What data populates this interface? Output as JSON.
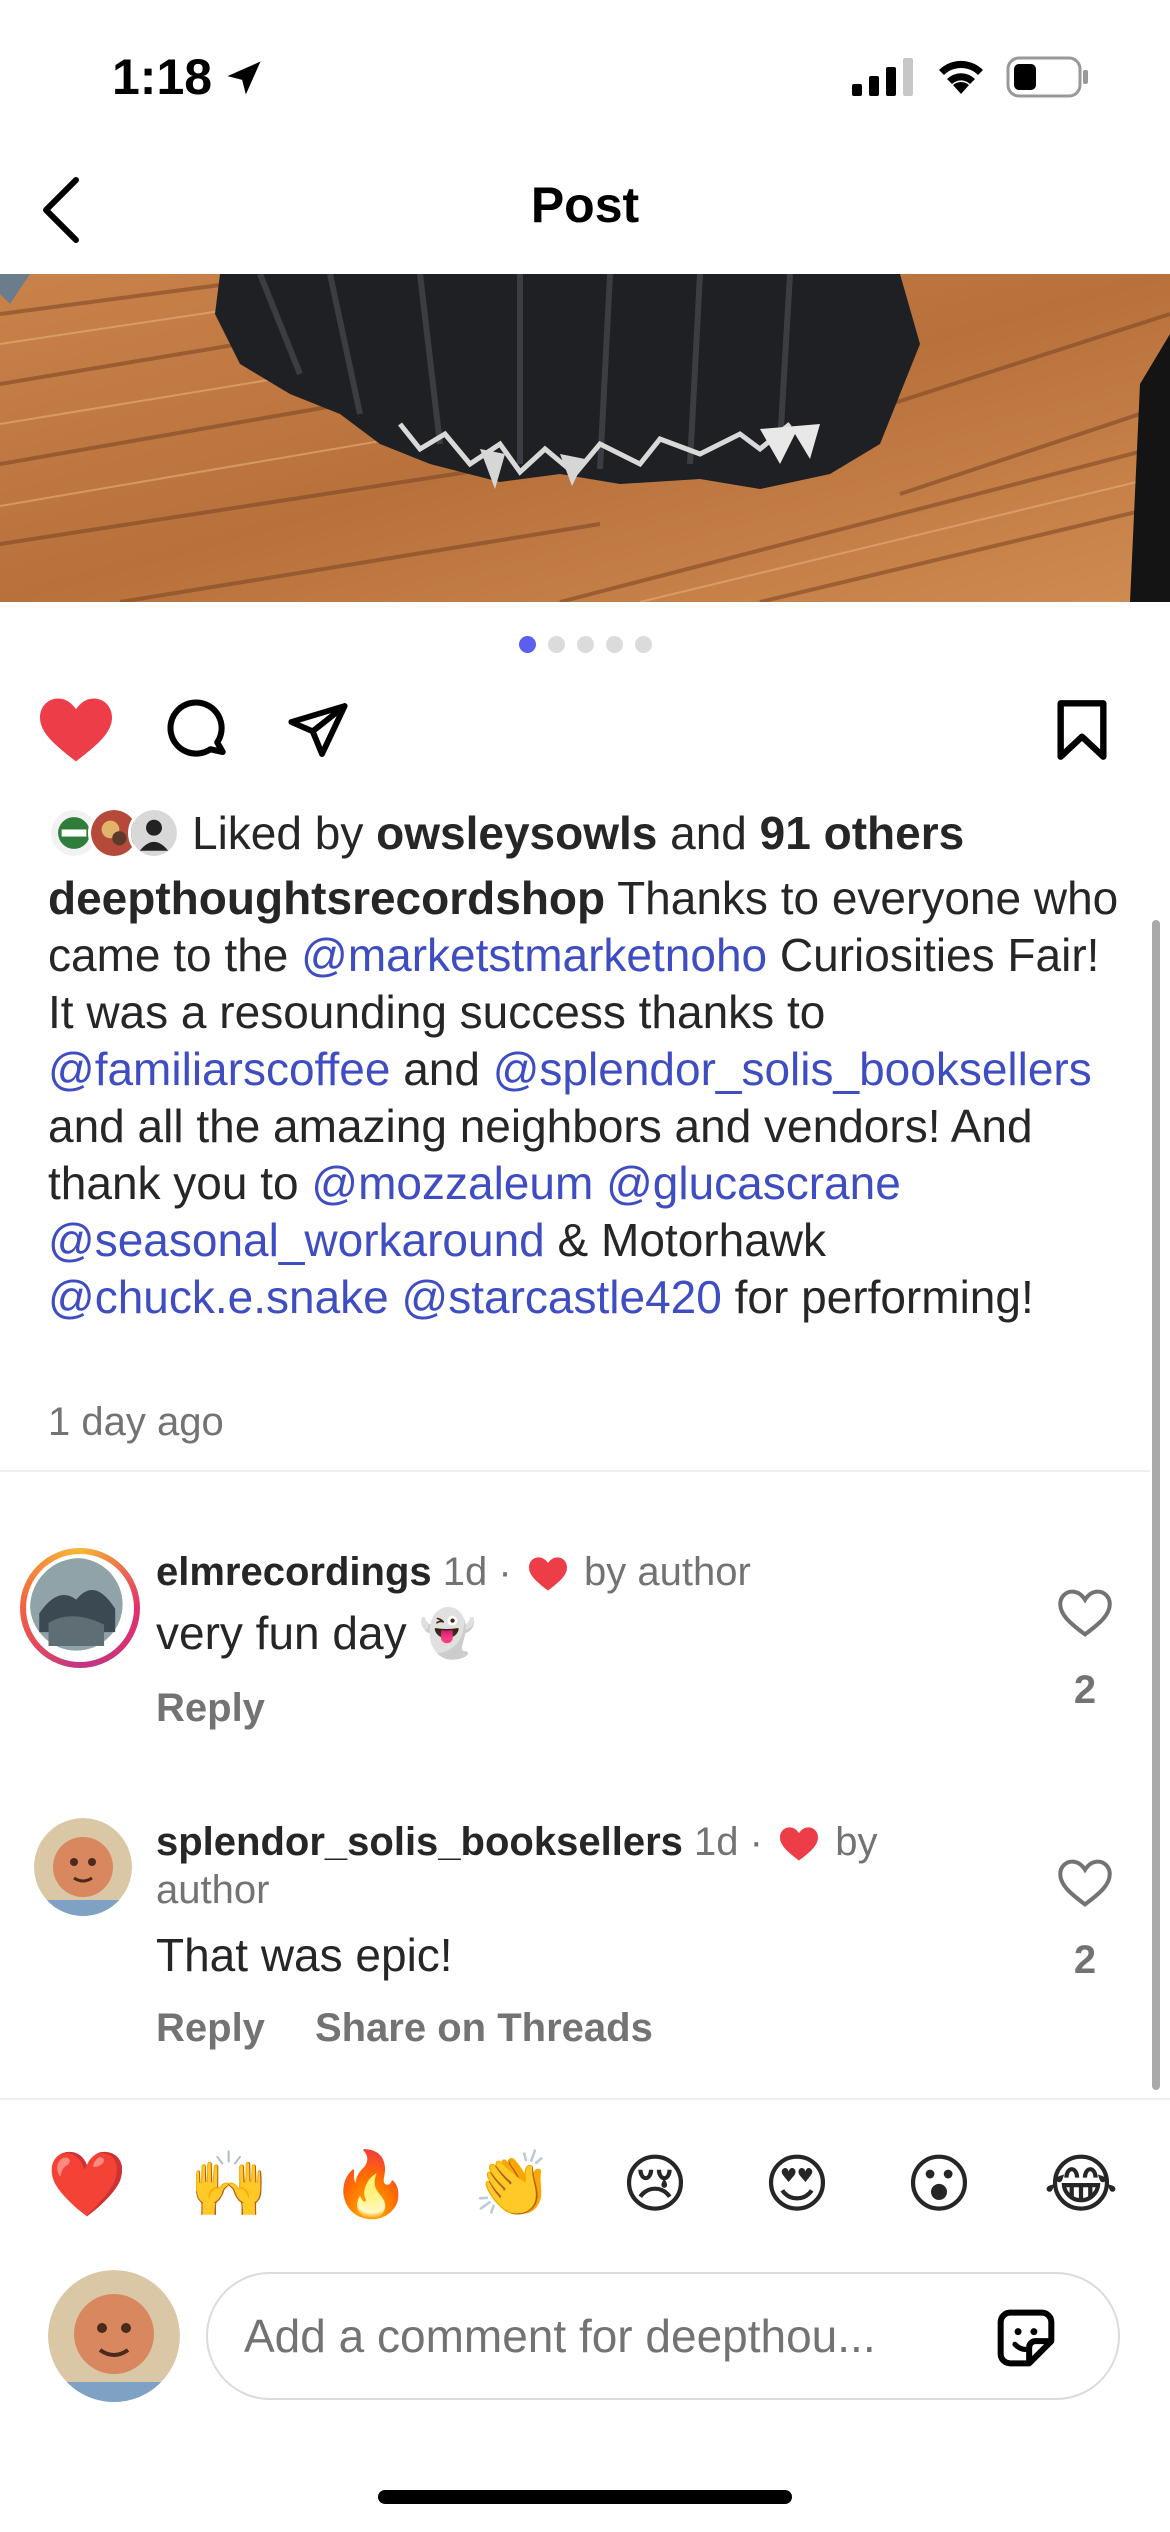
{
  "status_bar": {
    "time": "1:18"
  },
  "header": {
    "title": "Post"
  },
  "carousel": {
    "count": 5,
    "active_index": 0
  },
  "likes": {
    "prefix": "Liked by ",
    "user": "owsleysowls",
    "middle": " and ",
    "others": "91 others"
  },
  "caption": {
    "author": "deepthoughtsrecordshop",
    "parts": [
      {
        "text": " Thanks to everyone who came to the "
      },
      {
        "text": "@marketstmarketnoho",
        "mention": true
      },
      {
        "text": " Curiosities Fair! It was a resounding success thanks to "
      },
      {
        "text": "@familiarscoffee",
        "mention": true
      },
      {
        "text": " and "
      },
      {
        "text": "@splendor_solis_booksellers",
        "mention": true
      },
      {
        "text": " and all the amazing neighbors and vendors! And thank you to "
      },
      {
        "text": "@mozzaleum",
        "mention": true
      },
      {
        "text": " "
      },
      {
        "text": "@glucascrane",
        "mention": true
      },
      {
        "text": " "
      },
      {
        "text": "@seasonal_workaround",
        "mention": true
      },
      {
        "text": " & Motorhawk "
      },
      {
        "text": "@chuck.e.snake",
        "mention": true
      },
      {
        "text": " "
      },
      {
        "text": "@starcastle420",
        "mention": true
      },
      {
        "text": " for performing!"
      }
    ],
    "timestamp": "1 day ago"
  },
  "comments": [
    {
      "username": "elmrecordings",
      "age": "1d",
      "separator": "·",
      "liked_by": "by author",
      "text": "very fun day 👻",
      "reply_label": "Reply",
      "like_count": "2"
    },
    {
      "username": "splendor_solis_booksellers",
      "age": "1d",
      "separator": "·",
      "liked_by": "by author",
      "text": "That was epic!",
      "reply_label": "Reply",
      "share_label": "Share on Threads",
      "like_count": "2"
    }
  ],
  "emoji_bar": [
    "❤️",
    "🙌",
    "🔥",
    "👏",
    "😢",
    "😍",
    "😮",
    "😂"
  ],
  "composer": {
    "placeholder": "Add a comment for deepthou..."
  },
  "colors": {
    "accent_like": "#ed3d48",
    "mention": "#3f4dc2",
    "secondary_text": "#737373"
  }
}
